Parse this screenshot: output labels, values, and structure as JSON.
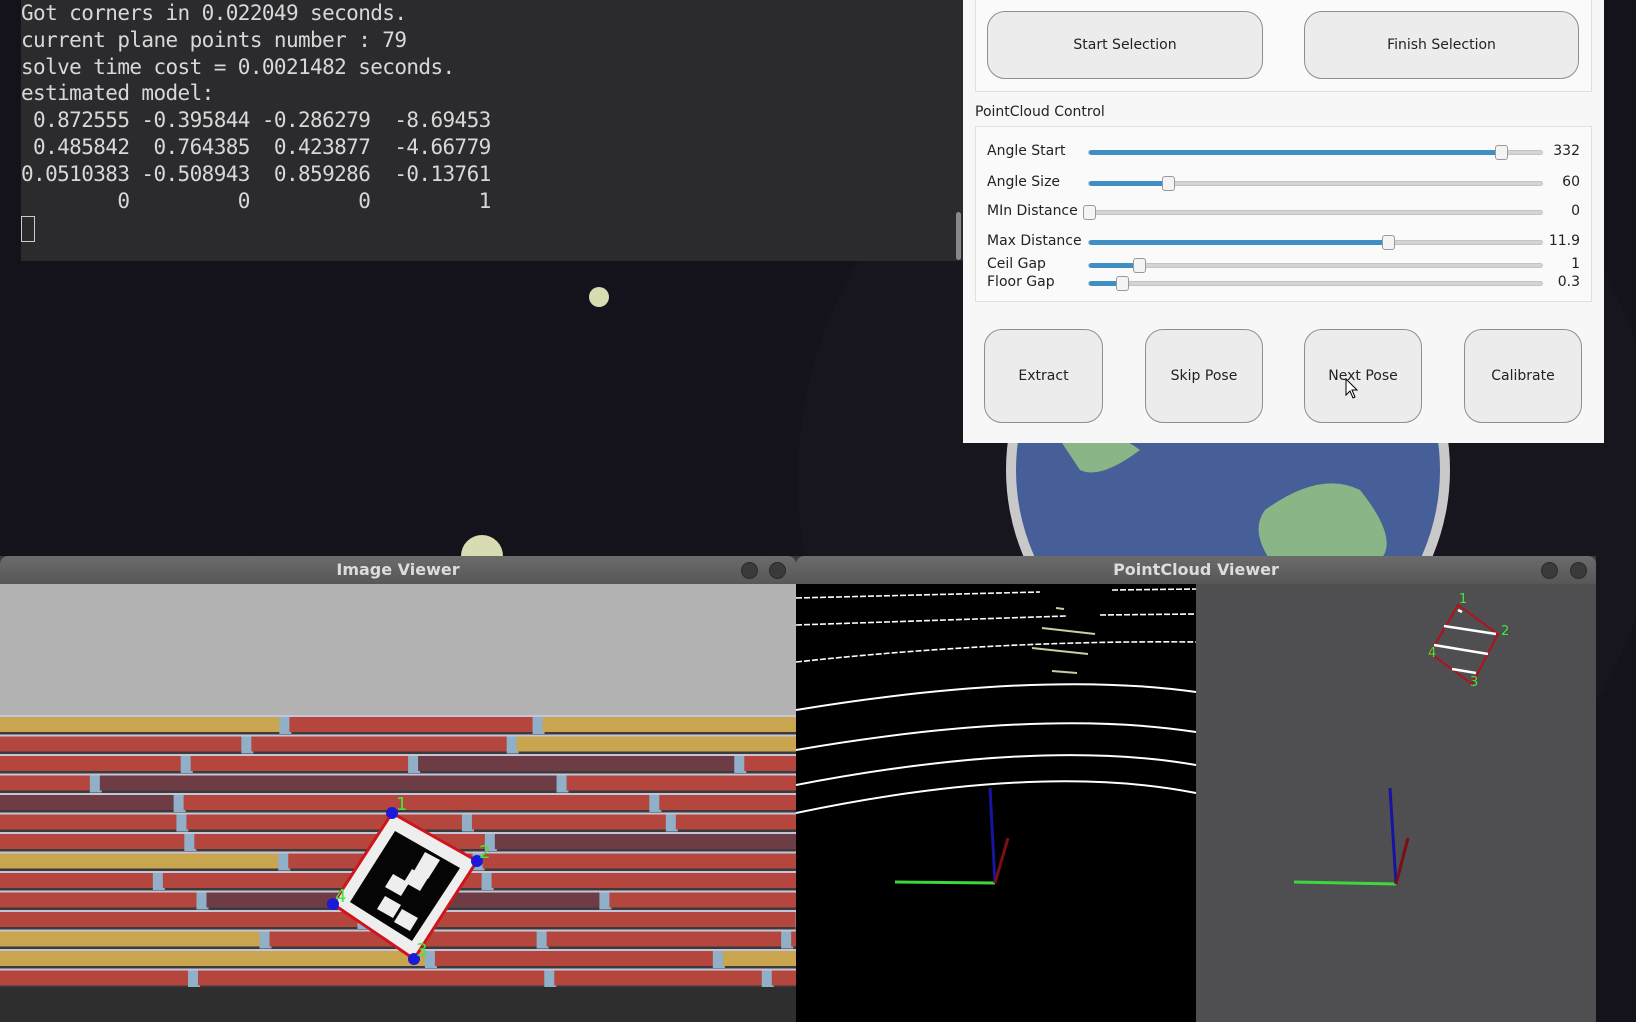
{
  "terminal": {
    "lines": [
      "Got corners in 0.022049 seconds.",
      "current plane points number : 79",
      "solve time cost = 0.0021482 seconds.",
      "estimated model:",
      " 0.872555 -0.395844 -0.286279  -8.69453",
      " 0.485842  0.764385  0.423877  -4.66779",
      "0.0510383 -0.508943  0.859286  -0.13761",
      "        0         0         0         1"
    ]
  },
  "panel": {
    "start_selection": "Start Selection",
    "finish_selection": "Finish Selection",
    "pointcloud_control_label": "PointCloud Control",
    "sliders": [
      {
        "label": "Angle Start",
        "value": "332",
        "level": 0.91
      },
      {
        "label": "Angle Size",
        "value": "60",
        "level": 0.175
      },
      {
        "label": "MIn Distance",
        "value": "0",
        "level": 0.0
      },
      {
        "label": "Max Distance",
        "value": "11.9",
        "level": 0.66
      },
      {
        "label": "Ceil Gap",
        "value": "1",
        "level": 0.11
      },
      {
        "label": "Floor Gap",
        "value": "0.3",
        "level": 0.073
      }
    ],
    "extract": "Extract",
    "skip_pose": "Skip Pose",
    "next_pose": "Next Pose",
    "calibrate": "Calibrate"
  },
  "image_viewer": {
    "title": "Image Viewer",
    "corner_labels": [
      "1",
      "2",
      "3",
      "4"
    ]
  },
  "pointcloud_viewer": {
    "title": "PointCloud Viewer",
    "corner_labels": [
      "1",
      "2",
      "3",
      "4"
    ]
  },
  "colors": {
    "slider_fill": "#3e8fc3",
    "marker_outline": "#d0141c",
    "corner_label": "#3ee83e",
    "corner_point": "#1a1ad8"
  }
}
